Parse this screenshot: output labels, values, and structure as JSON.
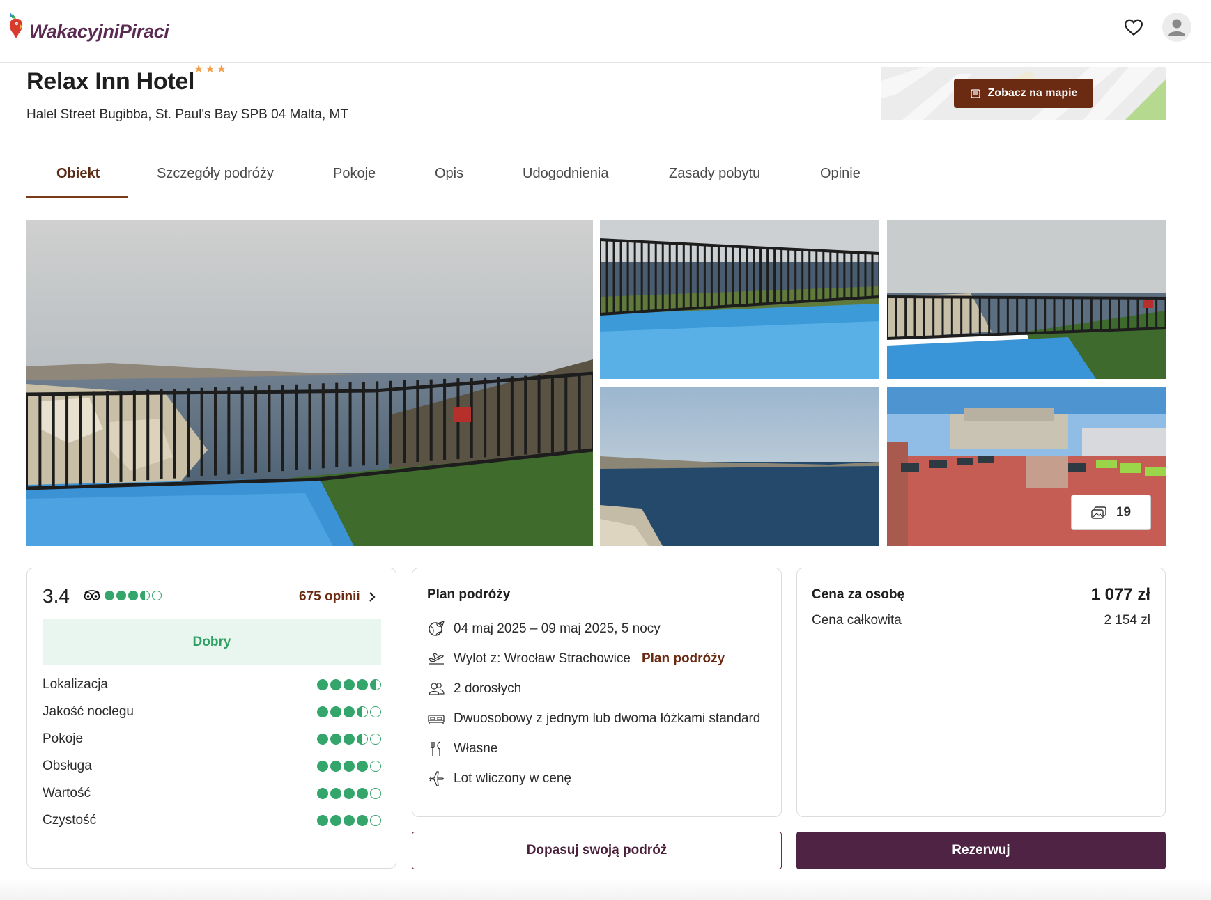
{
  "header": {
    "logo_text": "WakacyjniPiraci",
    "icons": [
      "heart-icon",
      "user-avatar-icon"
    ]
  },
  "hotel": {
    "name": "Relax Inn Hotel",
    "stars": 3,
    "address": "Halel Street Bugibba, St. Paul's Bay SPB 04 Malta, MT",
    "map_button_label": "Zobacz na mapie"
  },
  "tabs": [
    {
      "label": "Obiekt",
      "active": true
    },
    {
      "label": "Szczegóły podróży",
      "active": false
    },
    {
      "label": "Pokoje",
      "active": false
    },
    {
      "label": "Opis",
      "active": false
    },
    {
      "label": "Udogodnienia",
      "active": false
    },
    {
      "label": "Zasady pobytu",
      "active": false
    },
    {
      "label": "Opinie",
      "active": false
    }
  ],
  "gallery": {
    "photo_count": "19"
  },
  "rating": {
    "score": "3.4",
    "score_dots": 3.5,
    "reviews_label": "675 opinii",
    "verdict": "Dobry",
    "categories": [
      {
        "label": "Lokalizacja",
        "dots": 4.5
      },
      {
        "label": "Jakość noclegu",
        "dots": 3.5
      },
      {
        "label": "Pokoje",
        "dots": 3.5
      },
      {
        "label": "Obsługa",
        "dots": 4
      },
      {
        "label": "Wartość",
        "dots": 4
      },
      {
        "label": "Czystość",
        "dots": 4
      }
    ],
    "colors": {
      "dot": "#34a56b",
      "verdict_bg": "#e8f6ef"
    }
  },
  "plan": {
    "title": "Plan podróży",
    "dates": "04 maj 2025 – 09 maj 2025, 5 nocy",
    "departure": "Wylot z: Wrocław Strachowice",
    "departure_link": "Plan podróży",
    "guests": "2 dorosłych",
    "room": "Dwuosobowy z jednym lub dwoma łóżkami standard",
    "board": "Własne",
    "flight": "Lot wliczony w cenę"
  },
  "price": {
    "per_person_label": "Cena za osobę",
    "per_person_value": "1 077 zł",
    "total_label": "Cena całkowita",
    "total_value": "2 154 zł"
  },
  "actions": {
    "adjust_label": "Dopasuj swoją podróż",
    "book_label": "Rezerwuj"
  },
  "colors": {
    "brand_purple": "#4e2344",
    "accent_brown": "#6b2a12",
    "star": "#f0a04b"
  }
}
